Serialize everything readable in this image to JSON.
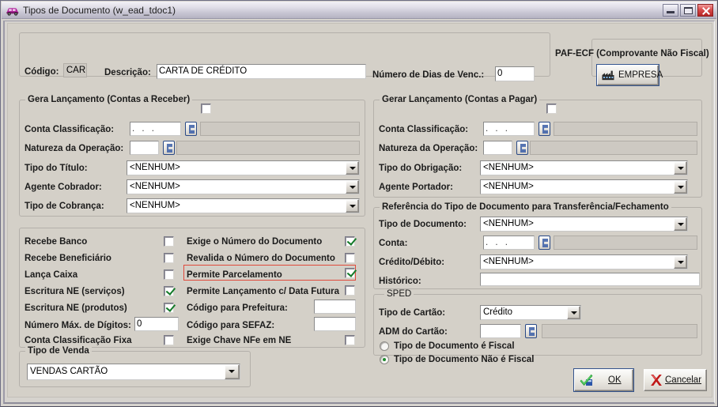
{
  "window": {
    "title": "Tipos de Documento (w_ead_tdoc1)",
    "icon": "car-icon",
    "buttons": {
      "minimize": "minimize-button",
      "maximize": "maximize-button",
      "close": "close-button"
    }
  },
  "header": {
    "codigo_label": "Código:",
    "codigo_value": "CAR",
    "descricao_label": "Descrição:",
    "descricao_value": "CARTA DE CRÉDITO",
    "dias_venc_label": "Número de Dias de Venc.:",
    "dias_venc_value": "0",
    "paf_ecf_title": "PAF-ECF (Comprovante Não Fiscal)",
    "empresa_button": "EMPRESA",
    "empresa_icon": "factory-icon"
  },
  "receber": {
    "group_title": "Gera Lançamento (Contas a Receber)",
    "group_checkbox_checked": false,
    "fields": [
      {
        "label": "Conta Classificação:",
        "value": ". . .",
        "type": "lookup",
        "desc": ""
      },
      {
        "label": "Natureza da Operação:",
        "value": "",
        "type": "lookup",
        "desc": ""
      },
      {
        "label": "Tipo do Título:",
        "value": "<NENHUM>",
        "type": "combo"
      },
      {
        "label": "Agente Cobrador:",
        "value": "<NENHUM>",
        "type": "combo"
      },
      {
        "label": "Tipo de Cobrança:",
        "value": "<NENHUM>",
        "type": "combo"
      }
    ]
  },
  "pagar": {
    "group_title": "Gerar Lançamento (Contas a Pagar)",
    "group_checkbox_checked": false,
    "fields": [
      {
        "label": "Conta Classificação:",
        "value": ". . .",
        "type": "lookup",
        "desc": ""
      },
      {
        "label": "Natureza da Operação:",
        "value": "",
        "type": "lookup",
        "desc": ""
      },
      {
        "label": "Tipo do Obrigação:",
        "value": "<NENHUM>",
        "type": "combo"
      },
      {
        "label": "Agente Portador:",
        "value": "<NENHUM>",
        "type": "combo"
      }
    ]
  },
  "referencia": {
    "group_title": "Referência do Tipo de Documento para Transferência/Fechamento",
    "tipo_documento_label": "Tipo de Documento:",
    "tipo_documento_value": "<NENHUM>",
    "conta_label": "Conta:",
    "conta_value": ". . .",
    "credito_debito_label": "Crédito/Débito:",
    "credito_debito_value": "<NENHUM>",
    "historico_label": "Histórico:",
    "historico_value": ""
  },
  "sped": {
    "group_title": "SPED",
    "tipo_cartao_label": "Tipo de Cartão:",
    "tipo_cartao_value": "Crédito",
    "adm_cartao_label": "ADM  do Cartão:",
    "adm_cartao_value": "",
    "adm_cartao_desc": "",
    "radios": [
      {
        "label": "Tipo de Documento é Fiscal",
        "checked": false
      },
      {
        "label": "Tipo de Documento Não é Fiscal",
        "checked": true
      }
    ]
  },
  "options_left": [
    {
      "label": "Recebe Banco",
      "checked": false
    },
    {
      "label": "Recebe Beneficiário",
      "checked": false
    },
    {
      "label": "Lança Caixa",
      "checked": false
    },
    {
      "label": "Escritura NE (serviços)",
      "checked": true
    },
    {
      "label": "Escritura NE (produtos)",
      "checked": true
    }
  ],
  "options_left_extra": {
    "num_max_digitos_label": "Número Máx. de Dígitos:",
    "num_max_digitos_value": "0",
    "conta_classificacao_fixa_label": "Conta Classificação Fixa",
    "conta_classificacao_fixa_checked": false
  },
  "options_right": [
    {
      "label": "Exige o Número do Documento",
      "checked": true,
      "highlight": false
    },
    {
      "label": "Revalida o Número do Documento",
      "checked": false,
      "highlight": false
    },
    {
      "label": "Permite Parcelamento",
      "checked": true,
      "highlight": true
    },
    {
      "label": "Permite Lançamento c/ Data Futura",
      "checked": false,
      "highlight": false
    }
  ],
  "options_right_extra": {
    "codigo_prefeitura_label": "Código para Prefeitura:",
    "codigo_prefeitura_value": "",
    "codigo_sefaz_label": "Código para SEFAZ:",
    "codigo_sefaz_value": "",
    "exige_chave_label": "Exige Chave NFe em NE",
    "exige_chave_checked": false
  },
  "tipo_venda": {
    "group_title": "Tipo de Venda",
    "value": "VENDAS CARTÃO"
  },
  "actions": {
    "ok_label": "OK",
    "ok_underline": "O",
    "cancel_label": "Cancelar",
    "cancel_underline": "C",
    "ok_icon": "green-check-icon",
    "cancel_icon": "red-x-icon"
  },
  "colors": {
    "window_bg": "#d4d0c8",
    "titlebar": "#dedce6",
    "highlight_red": "#e04a3c",
    "check_green": "#147a2a",
    "close_red": "#d84c4c"
  }
}
